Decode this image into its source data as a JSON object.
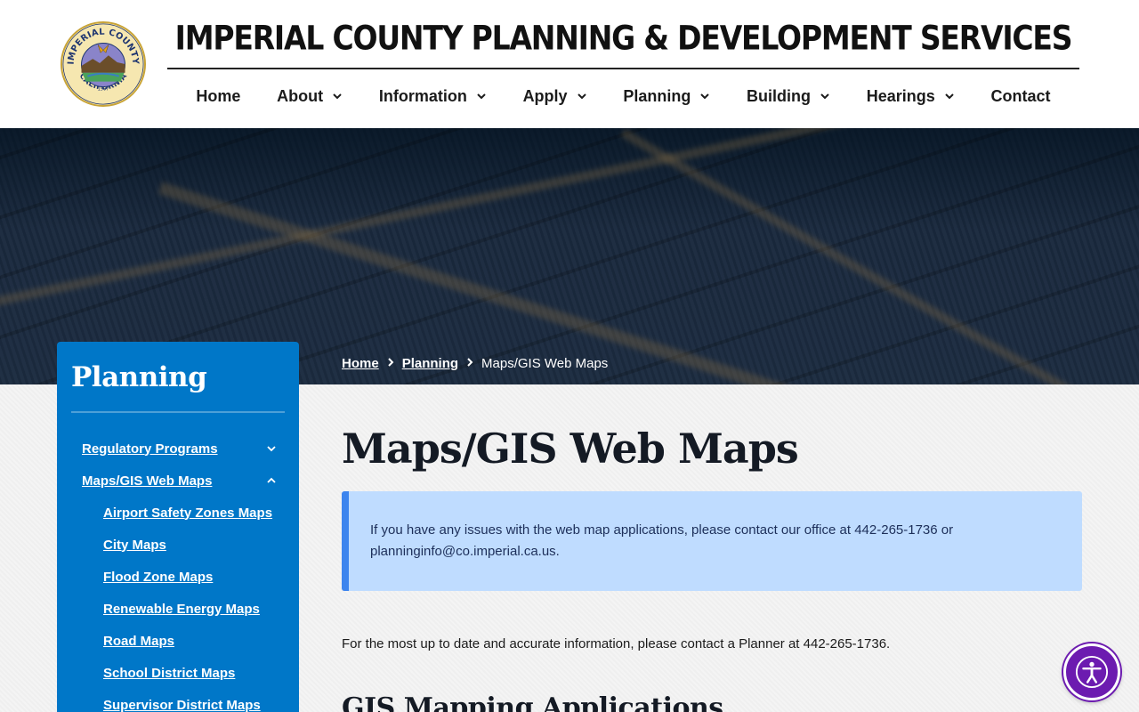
{
  "header": {
    "site_title": "IMPERIAL COUNTY PLANNING & DEVELOPMENT SERVICES",
    "seal": {
      "top_text": "IMPERIAL COUNTY",
      "bottom_text": "CALIFORNIA",
      "year": "1907"
    }
  },
  "nav": {
    "items": [
      {
        "label": "Home",
        "dropdown": false
      },
      {
        "label": "About",
        "dropdown": true
      },
      {
        "label": "Information",
        "dropdown": true
      },
      {
        "label": "Apply",
        "dropdown": true
      },
      {
        "label": "Planning",
        "dropdown": true
      },
      {
        "label": "Building",
        "dropdown": true
      },
      {
        "label": "Hearings",
        "dropdown": true
      },
      {
        "label": "Contact",
        "dropdown": false
      }
    ]
  },
  "breadcrumb": {
    "items": [
      "Home",
      "Planning"
    ],
    "current": "Maps/GIS Web Maps"
  },
  "sidebar": {
    "title": "Planning",
    "items": [
      {
        "label": "Regulatory Programs",
        "expanded": false
      },
      {
        "label": "Maps/GIS Web Maps",
        "expanded": true
      }
    ],
    "subitems": [
      "Airport Safety Zones Maps",
      "City Maps",
      "Flood Zone Maps",
      "Renewable Energy Maps",
      "Road Maps",
      "School District Maps",
      "Supervisor District Maps"
    ]
  },
  "main": {
    "page_title": "Maps/GIS Web Maps",
    "alert_text": "If you have any issues with the web map applications, please contact our office at 442-265-1736 or planninginfo@co.imperial.ca.us.",
    "paragraph": "For the most up to date and accurate information, please contact a Planner at 442-265-1736.",
    "section_heading": "GIS Mapping Applications"
  },
  "colors": {
    "sidebar_bg": "#0077c8",
    "alert_bg": "#bfdcff",
    "alert_border": "#3d85ee",
    "a11y_button": "#6c1bb0"
  },
  "icons": {
    "accessibility": "accessibility-person-icon",
    "chevron": "chevron-down-icon"
  }
}
